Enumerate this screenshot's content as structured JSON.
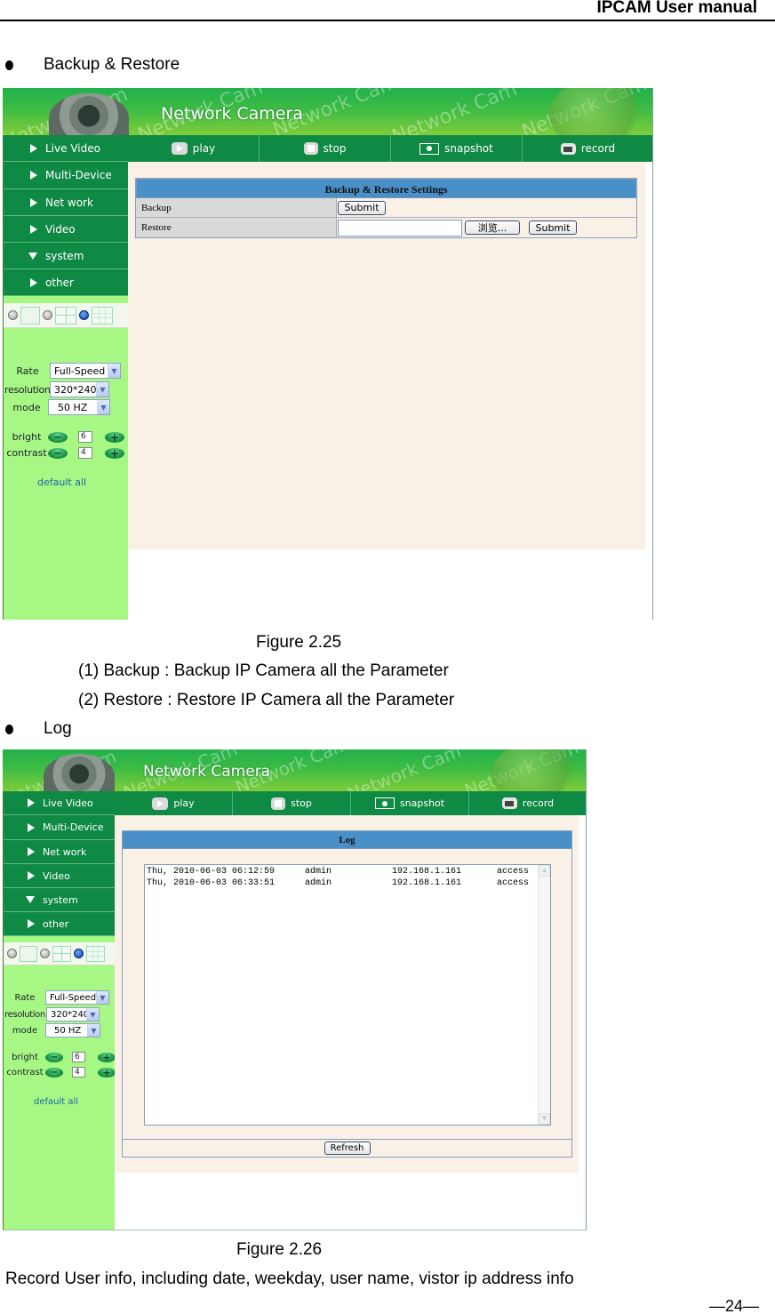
{
  "header": {
    "title": "IPCAM User manual"
  },
  "section1": {
    "bullet": "Backup & Restore",
    "figure_caption": "Figure 2.25",
    "notes": [
      "(1)  Backup : Backup IP Camera all the Parameter",
      "(2)  Restore : Restore IP Camera all the Parameter"
    ]
  },
  "section2": {
    "bullet": "Log",
    "figure_caption": "Figure 2.26",
    "description": "Record User info, including date, weekday, user name, vistor ip address info"
  },
  "footer": {
    "page_number": "—24—"
  },
  "camera_ui": {
    "banner_title": "Network Camera",
    "watermark": "Network Cam",
    "toolbar": [
      {
        "icon": "play-icon",
        "label": "play"
      },
      {
        "icon": "stop-icon",
        "label": "stop"
      },
      {
        "icon": "snapshot-icon",
        "label": "snapshot"
      },
      {
        "icon": "record-icon",
        "label": "record"
      }
    ],
    "nav": [
      {
        "label": "Live Video",
        "expanded": false
      },
      {
        "label": "Multi-Device",
        "expanded": false
      },
      {
        "label": "Net work",
        "expanded": false
      },
      {
        "label": "Video",
        "expanded": false
      },
      {
        "label": "system",
        "expanded": true
      },
      {
        "label": "other",
        "expanded": false
      }
    ],
    "layout_selected": "9-grid",
    "controls": {
      "rate_label": "Rate",
      "rate_value": "Full-Speed",
      "resolution_label": "resolution",
      "resolution_value": "320*240",
      "mode_label": "mode",
      "mode_value": "50 HZ",
      "bright_label": "bright",
      "bright_value": "6",
      "contrast_label": "contrast",
      "contrast_value": "4",
      "minus": "−",
      "plus": "+",
      "default_all": "default all"
    }
  },
  "backup_panel": {
    "title": "Backup & Restore Settings",
    "rows": [
      {
        "label": "Backup",
        "button": "Submit"
      },
      {
        "label": "Restore",
        "file_value": "",
        "browse": "浏览...",
        "button": "Submit"
      }
    ]
  },
  "log_panel": {
    "title": "Log",
    "entries": [
      {
        "datetime": "Thu, 2010-06-03 06:12:59",
        "user": "admin",
        "ip": "192.168.1.161",
        "action": "access"
      },
      {
        "datetime": "Thu, 2010-06-03 06:33:51",
        "user": "admin",
        "ip": "192.168.1.161",
        "action": "access"
      }
    ],
    "refresh": "Refresh"
  },
  "colors": {
    "nav_green": "#0f8a45",
    "sidebar_green": "#a6f783",
    "content_bg": "#f9f0e6",
    "panel_header": "#4a90c8"
  }
}
